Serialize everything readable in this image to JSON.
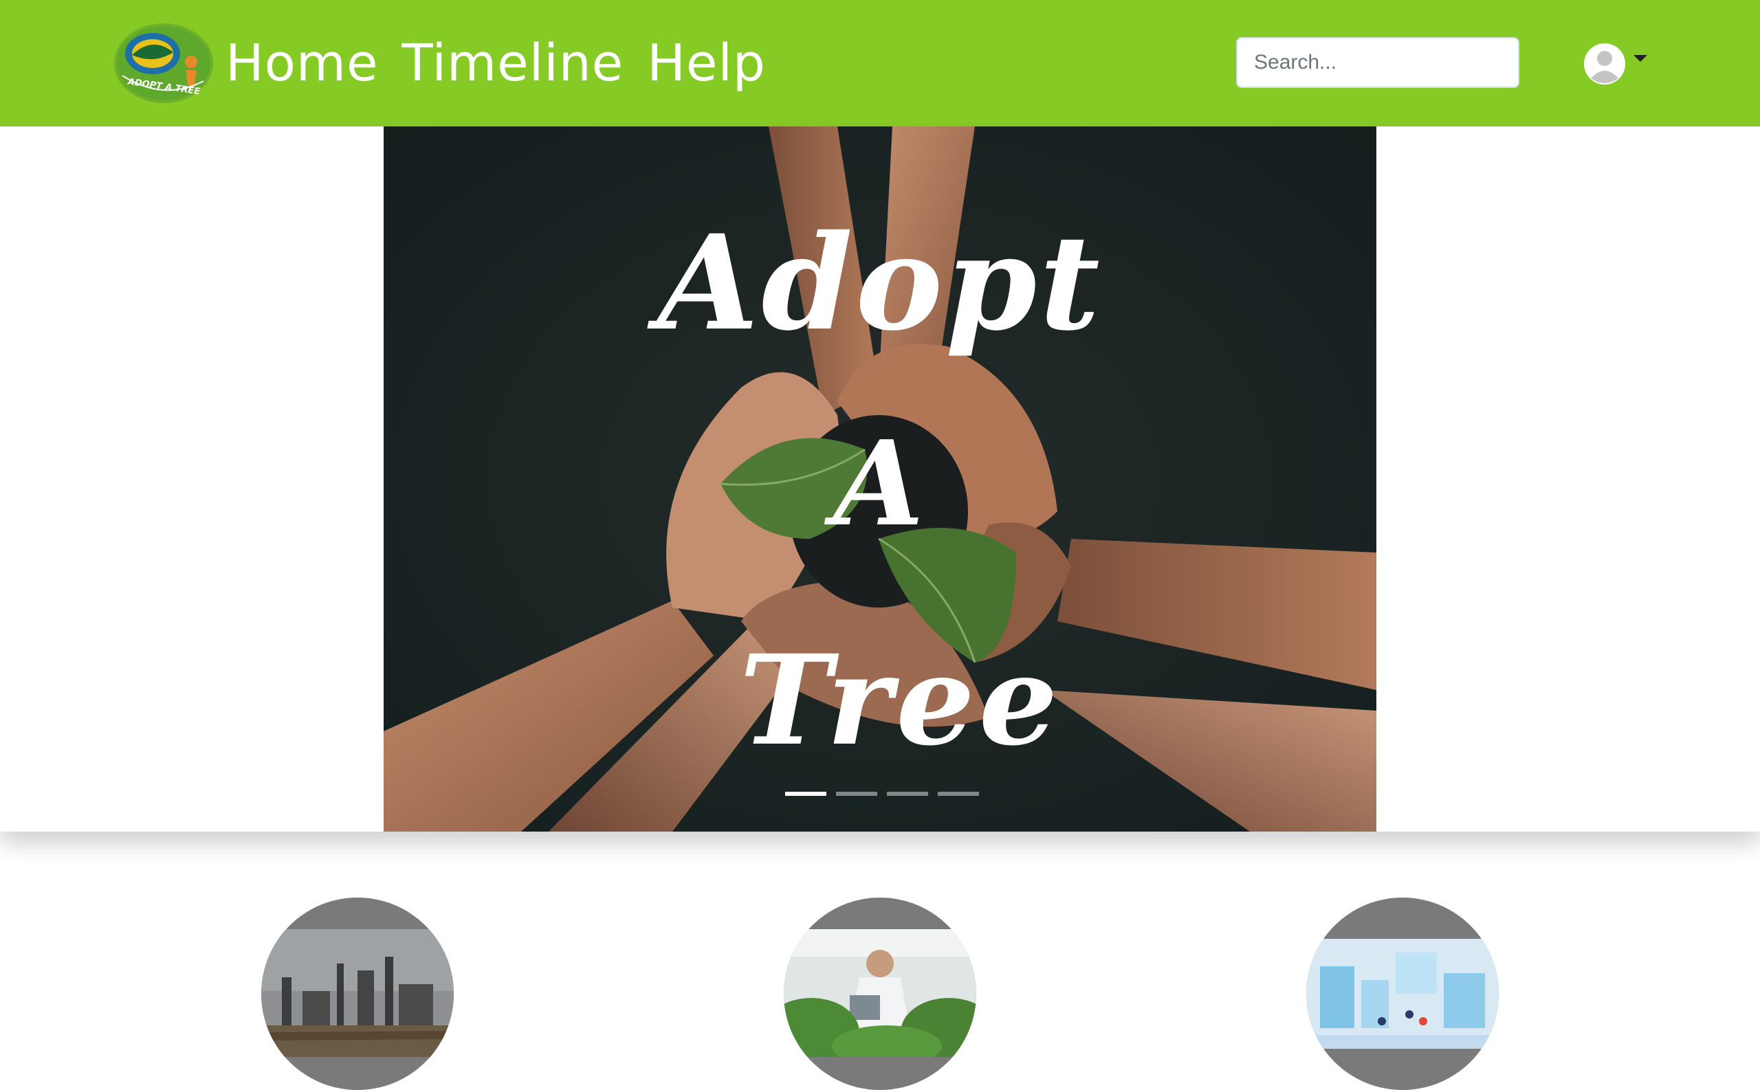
{
  "navbar": {
    "logo_text": "ADOPT A TREE",
    "links": [
      {
        "label": "Home"
      },
      {
        "label": "Timeline"
      },
      {
        "label": "Help"
      }
    ],
    "search_placeholder": "Search...",
    "user_icon": "user-avatar-icon",
    "caret_icon": "caret-down-icon"
  },
  "hero": {
    "title_line1": "Adopt",
    "title_line2": "A",
    "title_line3": "Tree",
    "slides": [
      {
        "active": true
      },
      {
        "active": false
      },
      {
        "active": false
      },
      {
        "active": false
      }
    ]
  },
  "features": [
    {
      "image": "factory-image"
    },
    {
      "image": "scientist-plants-image"
    },
    {
      "image": "data-center-illustration"
    }
  ],
  "colors": {
    "navbar": "#86cb25",
    "white": "#ffffff",
    "circle_bg": "#7a7a7a"
  }
}
